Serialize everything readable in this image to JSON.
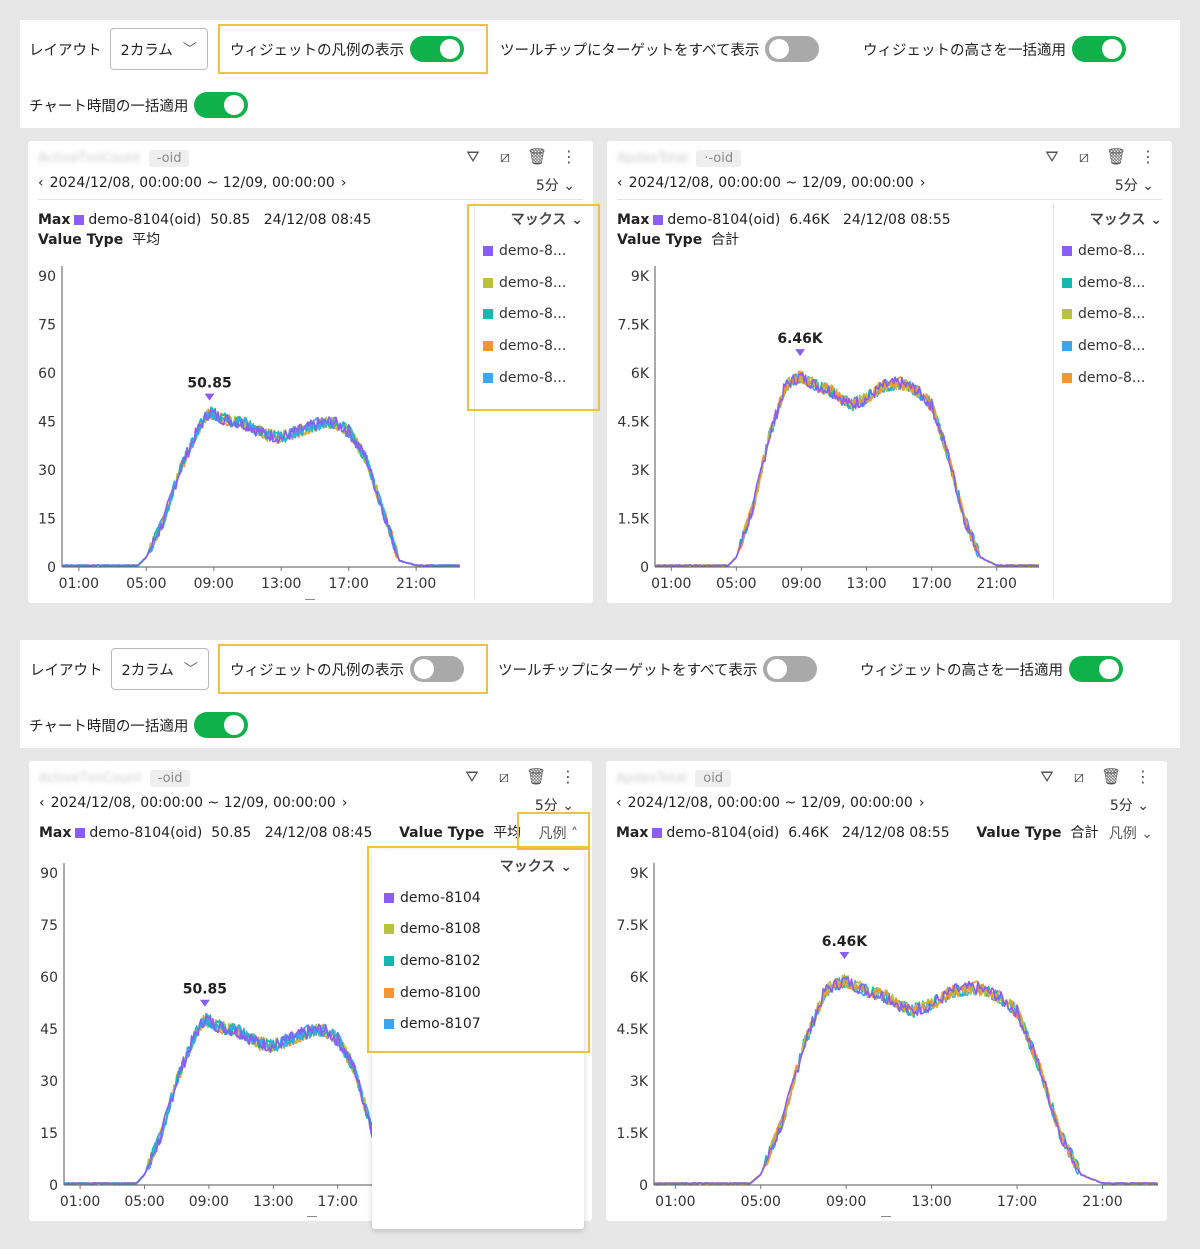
{
  "colors": {
    "purple": "#8b5cf6",
    "olive": "#b8c23a",
    "teal": "#13b8b0",
    "orange": "#f7962e",
    "blue": "#3aa6f2",
    "toggle_on": "#0fb24a",
    "toggle_off": "#a9a9a9",
    "highlight": "#f0c040"
  },
  "top": {
    "layout_label": "レイアウト",
    "layout_value": "2カラム",
    "legend_toggle_label": "ウィジェットの凡例の表示",
    "legend_toggle_on": true,
    "tooltip_toggle_label": "ツールチップにターゲットをすべて表示",
    "tooltip_toggle_on": false,
    "height_toggle_label": "ウィジェットの高さを一括適用",
    "height_toggle_on": true,
    "time_toggle_label": "チャート時間の一括適用",
    "time_toggle_on": true
  },
  "bottom": {
    "layout_label": "レイアウト",
    "layout_value": "2カラム",
    "legend_toggle_label": "ウィジェットの凡例の表示",
    "legend_toggle_on": false,
    "tooltip_toggle_label": "ツールチップにターゲットをすべて表示",
    "tooltip_toggle_on": false,
    "height_toggle_label": "ウィジェットの高さを一括適用",
    "height_toggle_on": true,
    "time_toggle_label": "チャート時間の一括適用",
    "time_toggle_on": true
  },
  "widget_left": {
    "title": "ActiveTxnCount",
    "oid_chip": "-oid",
    "date_range": "2024/12/08, 00:00:00 ~ 12/09, 00:00:00",
    "interval": "5分",
    "max_label": "Max",
    "max_target": "demo-8104(oid)",
    "max_value": "50.85",
    "max_time": "24/12/08 08:45",
    "value_type_label": "Value Type",
    "value_type": "平均",
    "peak_label": "50.85",
    "legend_header": "マックス",
    "legend_toggle": "凡例",
    "legend_items_short": [
      "demo-8...",
      "demo-8...",
      "demo-8...",
      "demo-8...",
      "demo-8..."
    ],
    "legend_items_full": [
      "demo-8104",
      "demo-8108",
      "demo-8102",
      "demo-8100",
      "demo-8107"
    ],
    "legend_colors": [
      "#8b5cf6",
      "#b8c23a",
      "#13b8b0",
      "#f7962e",
      "#3aa6f2"
    ]
  },
  "widget_right": {
    "title": "ApdexTotal",
    "oid_chip": "oid",
    "date_range": "2024/12/08, 00:00:00 ~ 12/09, 00:00:00",
    "interval": "5分",
    "max_label": "Max",
    "max_target": "demo-8104(oid)",
    "max_value": "6.46K",
    "max_time": "24/12/08 08:55",
    "value_type_label": "Value Type",
    "value_type": "合計",
    "peak_label": "6.46K",
    "legend_header": "マックス",
    "legend_toggle": "凡例",
    "legend_items_short": [
      "demo-8...",
      "demo-8...",
      "demo-8...",
      "demo-8...",
      "demo-8..."
    ],
    "legend_colors": [
      "#8b5cf6",
      "#13b8b0",
      "#b8c23a",
      "#3aa6f2",
      "#f7962e"
    ]
  },
  "chart_data": [
    {
      "type": "line",
      "title": "ActiveTxnCount",
      "x_ticks": [
        "01:00",
        "05:00",
        "09:00",
        "13:00",
        "17:00",
        "21:00"
      ],
      "y_ticks": [
        "0",
        "15",
        "30",
        "45",
        "60",
        "75",
        "90"
      ],
      "ylim": [
        0,
        90
      ],
      "series": [
        {
          "name": "demo-8104",
          "color": "#8b5cf6"
        },
        {
          "name": "demo-8108",
          "color": "#b8c23a"
        },
        {
          "name": "demo-8102",
          "color": "#13b8b0"
        },
        {
          "name": "demo-8100",
          "color": "#f7962e"
        },
        {
          "name": "demo-8107",
          "color": "#3aa6f2"
        }
      ],
      "profile_hours": [
        0,
        4.5,
        5,
        6,
        7,
        8,
        8.75,
        9.5,
        11,
        12,
        13,
        14,
        15,
        16,
        17,
        18,
        19,
        20,
        21,
        23.5
      ],
      "profile_values": [
        0.5,
        0.5,
        3,
        14,
        30,
        42,
        48,
        46,
        44,
        41,
        40,
        42,
        44,
        45,
        42,
        34,
        18,
        2,
        0.5,
        0.5
      ],
      "max_point": {
        "x": "08:45",
        "y": 50.85
      }
    },
    {
      "type": "line",
      "title": "ApdexTotal",
      "x_ticks": [
        "01:00",
        "05:00",
        "09:00",
        "13:00",
        "17:00",
        "21:00"
      ],
      "y_ticks": [
        "0",
        "1.5K",
        "3K",
        "4.5K",
        "6K",
        "7.5K",
        "9K"
      ],
      "ylim": [
        0,
        9000
      ],
      "series": [
        {
          "name": "demo-8104",
          "color": "#8b5cf6"
        },
        {
          "name": "demo-8...",
          "color": "#13b8b0"
        },
        {
          "name": "demo-8...",
          "color": "#b8c23a"
        },
        {
          "name": "demo-8...",
          "color": "#3aa6f2"
        },
        {
          "name": "demo-8...",
          "color": "#f7962e"
        }
      ],
      "profile_hours": [
        0,
        4.5,
        5,
        6,
        7,
        8,
        8.9,
        10,
        11,
        12,
        13,
        14,
        15,
        16,
        17,
        18,
        19,
        20,
        21,
        23.5
      ],
      "profile_values": [
        50,
        50,
        300,
        1800,
        4000,
        5600,
        5900,
        5600,
        5400,
        5000,
        5200,
        5600,
        5700,
        5500,
        5000,
        3500,
        1500,
        300,
        50,
        50
      ],
      "max_point": {
        "x": "08:55",
        "y": 6460
      }
    }
  ]
}
